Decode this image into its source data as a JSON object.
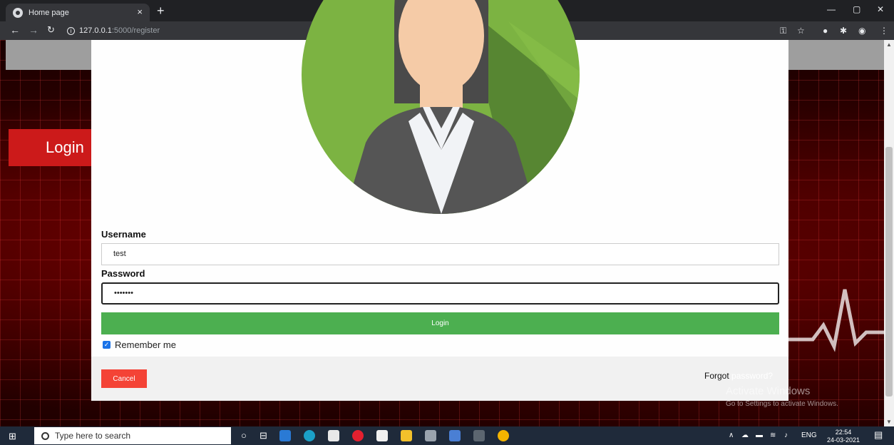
{
  "browser": {
    "tab_title": "Home page",
    "tab_close": "×",
    "new_tab": "+",
    "url_host": "127.0.0.1",
    "url_path": ":5000/register",
    "window_minimize": "—",
    "window_maximize": "▢",
    "window_close": "✕"
  },
  "page": {
    "header_login": "Login"
  },
  "form": {
    "username_label": "Username",
    "username_value": "test",
    "password_label": "Password",
    "password_value": "•••••••",
    "login_button": "Login",
    "remember_label": "Remember me",
    "remember_checked": true,
    "cancel_button": "Cancel",
    "forgot_text": "Forgot",
    "forgot_link": "password?"
  },
  "watermark": {
    "line1": "Activate Windows",
    "line2": "Go to Settings to activate Windows."
  },
  "taskbar": {
    "search_placeholder": "Type here to search",
    "language": "ENG",
    "time": "22:54",
    "date": "24-03-2021"
  },
  "colors": {
    "login_button": "#4caf50",
    "cancel_button": "#f44336",
    "header_login": "#cc1a1a",
    "avatar_bg": "#7cb342"
  }
}
